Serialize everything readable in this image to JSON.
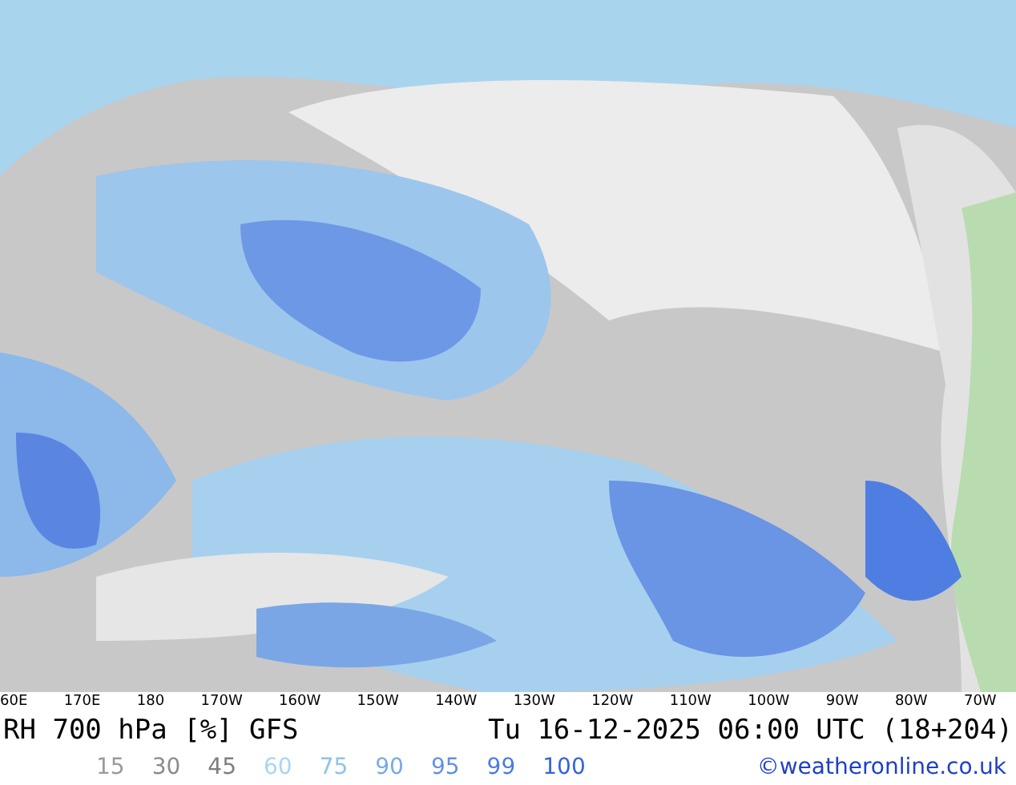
{
  "longitude_labels": [
    "60E",
    "170E",
    "180",
    "170W",
    "160W",
    "150W",
    "140W",
    "130W",
    "120W",
    "110W",
    "100W",
    "90W",
    "80W",
    "70W"
  ],
  "title": "RH 700 hPa [%] GFS",
  "valid_time": "Tu 16-12-2025 06:00 UTC (18+204)",
  "legend": [
    {
      "label": "15",
      "color": "#9a9a9a"
    },
    {
      "label": "30",
      "color": "#8c8c8c"
    },
    {
      "label": "45",
      "color": "#7e7e7e"
    },
    {
      "label": "60",
      "color": "#a8d6f0"
    },
    {
      "label": "75",
      "color": "#8cc4ea"
    },
    {
      "label": "90",
      "color": "#78aae8"
    },
    {
      "label": "95",
      "color": "#6090e6"
    },
    {
      "label": "99",
      "color": "#4a7ae4"
    },
    {
      "label": "100",
      "color": "#3464e0"
    }
  ],
  "copyright": "©weatheronline.co.uk"
}
